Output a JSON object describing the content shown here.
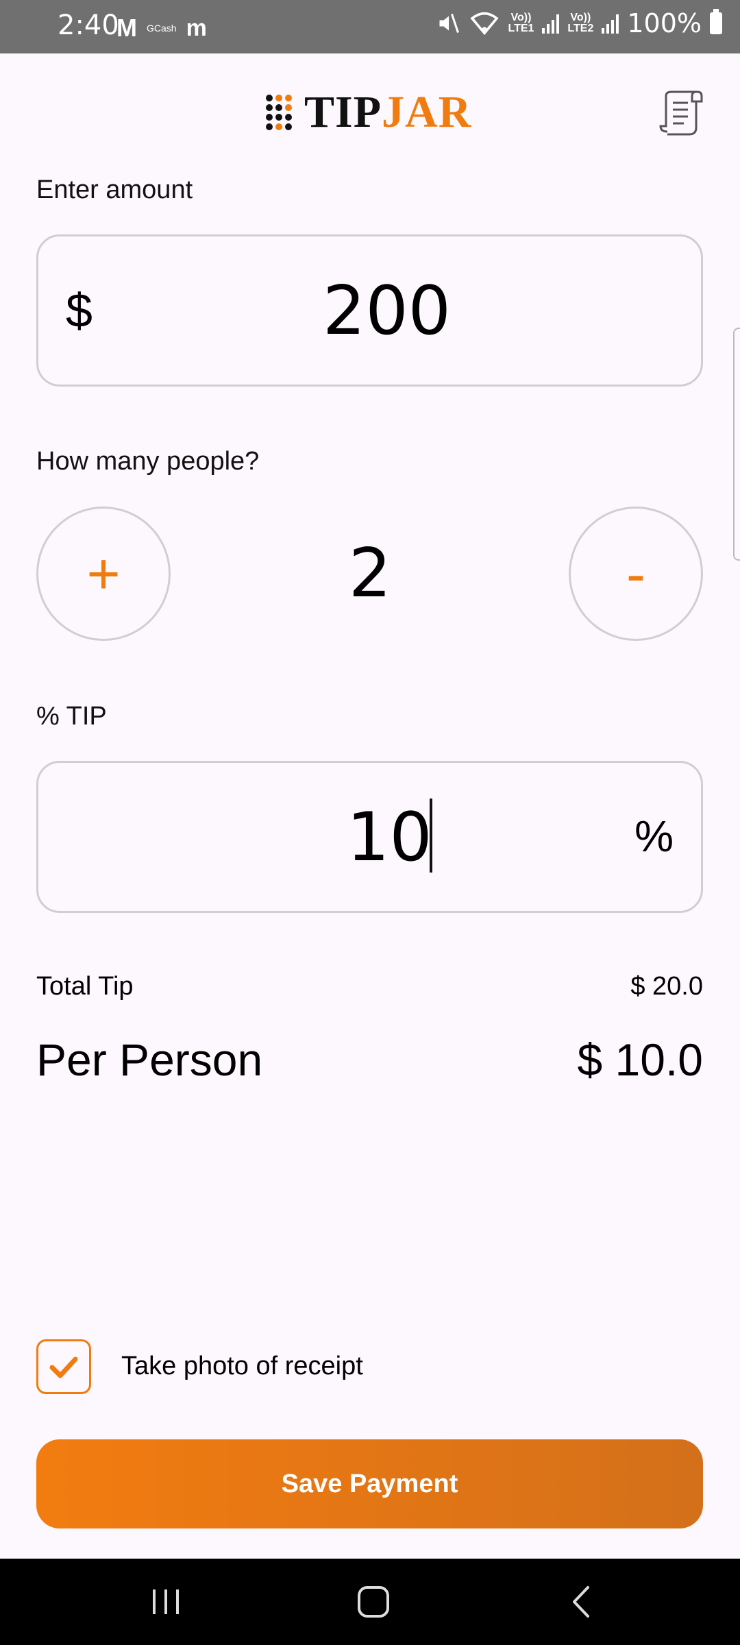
{
  "status_bar": {
    "time": "2:40",
    "gmail": "M",
    "gcash": "GCash",
    "messenger": "m",
    "lte1": "Vo))\nLTE1",
    "lte2": "Vo))\nLTE2",
    "battery": "100%"
  },
  "header": {
    "logo_part1": "TIP",
    "logo_part2": "JAR",
    "brand_color": "#f07c10",
    "receipt_icon": "receipt-icon"
  },
  "amount": {
    "label": "Enter amount",
    "currency_symbol": "$",
    "value": "200"
  },
  "people": {
    "label": "How many people?",
    "plus_label": "+",
    "minus_label": "-",
    "count": "2"
  },
  "tip": {
    "label": "% TIP",
    "value": "10",
    "percent_symbol": "%"
  },
  "totals": {
    "total_tip_label": "Total Tip",
    "total_tip_value": "$ 20.0",
    "per_person_label": "Per Person",
    "per_person_value": "$ 10.0"
  },
  "receipt_option": {
    "label": "Take photo of receipt",
    "checked": true
  },
  "actions": {
    "save_label": "Save Payment"
  }
}
